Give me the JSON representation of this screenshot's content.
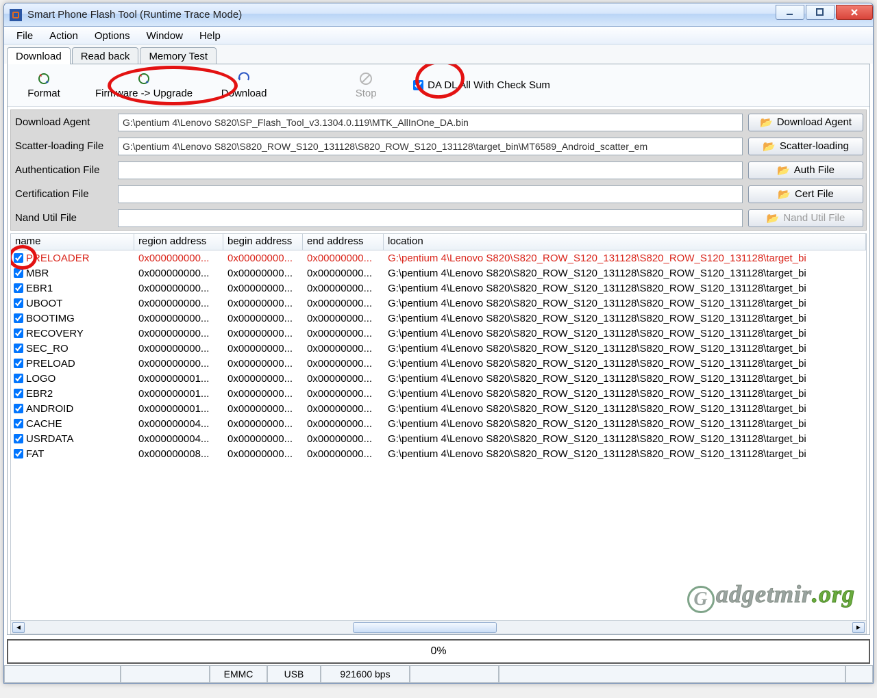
{
  "window": {
    "title": "Smart Phone Flash Tool (Runtime Trace Mode)"
  },
  "menu": [
    "File",
    "Action",
    "Options",
    "Window",
    "Help"
  ],
  "tabs": {
    "items": [
      "Download",
      "Read back",
      "Memory Test"
    ],
    "active": 0
  },
  "toolbar": {
    "format": "Format",
    "firmware_upgrade": "Firmware -> Upgrade",
    "download": "Download",
    "stop": "Stop",
    "da_checksum": "DA DL All With Check Sum"
  },
  "files": {
    "labels": {
      "download_agent": "Download Agent",
      "scatter": "Scatter-loading File",
      "auth": "Authentication File",
      "cert": "Certification File",
      "nand": "Nand Util File"
    },
    "values": {
      "download_agent": "G:\\pentium 4\\Lenovo S820\\SP_Flash_Tool_v3.1304.0.119\\MTK_AllInOne_DA.bin",
      "scatter": "G:\\pentium 4\\Lenovo S820\\S820_ROW_S120_131128\\S820_ROW_S120_131128\\target_bin\\MT6589_Android_scatter_em",
      "auth": "",
      "cert": "",
      "nand": ""
    },
    "buttons": {
      "download_agent": "Download Agent",
      "scatter": "Scatter-loading",
      "auth": "Auth File",
      "cert": "Cert File",
      "nand": "Nand Util File"
    }
  },
  "table": {
    "headers": {
      "name": "name",
      "region": "region address",
      "begin": "begin address",
      "end": "end address",
      "location": "location"
    },
    "location_common": "G:\\pentium 4\\Lenovo S820\\S820_ROW_S120_131128\\S820_ROW_S120_131128\\target_bi",
    "rows": [
      {
        "checked": true,
        "name": "PRELOADER",
        "region": "0x000000000...",
        "begin": "0x00000000...",
        "end": "0x00000000...",
        "highlight": true
      },
      {
        "checked": true,
        "name": "MBR",
        "region": "0x000000000...",
        "begin": "0x00000000...",
        "end": "0x00000000..."
      },
      {
        "checked": true,
        "name": "EBR1",
        "region": "0x000000000...",
        "begin": "0x00000000...",
        "end": "0x00000000..."
      },
      {
        "checked": true,
        "name": "UBOOT",
        "region": "0x000000000...",
        "begin": "0x00000000...",
        "end": "0x00000000..."
      },
      {
        "checked": true,
        "name": "BOOTIMG",
        "region": "0x000000000...",
        "begin": "0x00000000...",
        "end": "0x00000000..."
      },
      {
        "checked": true,
        "name": "RECOVERY",
        "region": "0x000000000...",
        "begin": "0x00000000...",
        "end": "0x00000000..."
      },
      {
        "checked": true,
        "name": "SEC_RO",
        "region": "0x000000000...",
        "begin": "0x00000000...",
        "end": "0x00000000..."
      },
      {
        "checked": true,
        "name": "PRELOAD",
        "region": "0x000000000...",
        "begin": "0x00000000...",
        "end": "0x00000000..."
      },
      {
        "checked": true,
        "name": "LOGO",
        "region": "0x000000001...",
        "begin": "0x00000000...",
        "end": "0x00000000..."
      },
      {
        "checked": true,
        "name": "EBR2",
        "region": "0x000000001...",
        "begin": "0x00000000...",
        "end": "0x00000000..."
      },
      {
        "checked": true,
        "name": "ANDROID",
        "region": "0x000000001...",
        "begin": "0x00000000...",
        "end": "0x00000000..."
      },
      {
        "checked": true,
        "name": "CACHE",
        "region": "0x000000004...",
        "begin": "0x00000000...",
        "end": "0x00000000..."
      },
      {
        "checked": true,
        "name": "USRDATA",
        "region": "0x000000004...",
        "begin": "0x00000000...",
        "end": "0x00000000..."
      },
      {
        "checked": true,
        "name": "FAT",
        "region": "0x000000008...",
        "begin": "0x00000000...",
        "end": "0x00000000..."
      }
    ]
  },
  "progress": {
    "text": "0%"
  },
  "status": {
    "cells": [
      "",
      "",
      "EMMC",
      "USB",
      "921600 bps",
      "",
      "",
      ""
    ]
  },
  "watermark": {
    "text1": "adgetmir",
    "text2": ".org"
  }
}
